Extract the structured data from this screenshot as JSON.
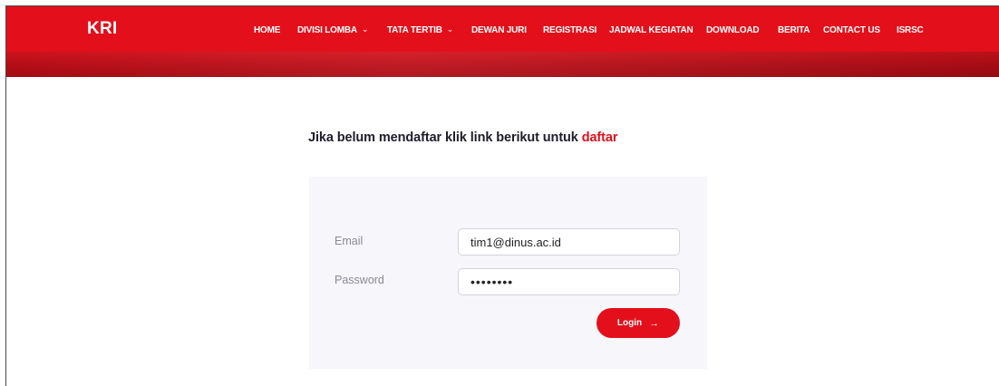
{
  "colors": {
    "brand_red": "#e30f1b",
    "band_red": "#b80d17",
    "card_bg": "#f6f6fb"
  },
  "navbar": {
    "brand": "KRI",
    "items": [
      {
        "label": "HOME",
        "dropdown": false
      },
      {
        "label": "DIVISI LOMBA",
        "dropdown": true
      },
      {
        "label": "TATA TERTIB",
        "dropdown": true
      },
      {
        "label": "DEWAN JURI",
        "dropdown": false
      },
      {
        "label": "REGISTRASI",
        "dropdown": false
      },
      {
        "label": "JADWAL KEGIATAN",
        "dropdown": false
      },
      {
        "label": "DOWNLOAD",
        "dropdown": false
      },
      {
        "label": "BERITA",
        "dropdown": false
      },
      {
        "label": "CONTACT US",
        "dropdown": false
      },
      {
        "label": "ISRSC",
        "dropdown": false
      }
    ],
    "dropdown_icon": "chevron-down-icon"
  },
  "main": {
    "headline_text": "Jika belum mendaftar klik link berikut untuk ",
    "headline_link": "daftar"
  },
  "login_form": {
    "email_label": "Email",
    "email_value": "tim1@dinus.ac.id",
    "password_label": "Password",
    "password_value": "••••••••",
    "login_label": "Login",
    "login_icon": "arrow-right-icon",
    "login_arrow": "→"
  }
}
